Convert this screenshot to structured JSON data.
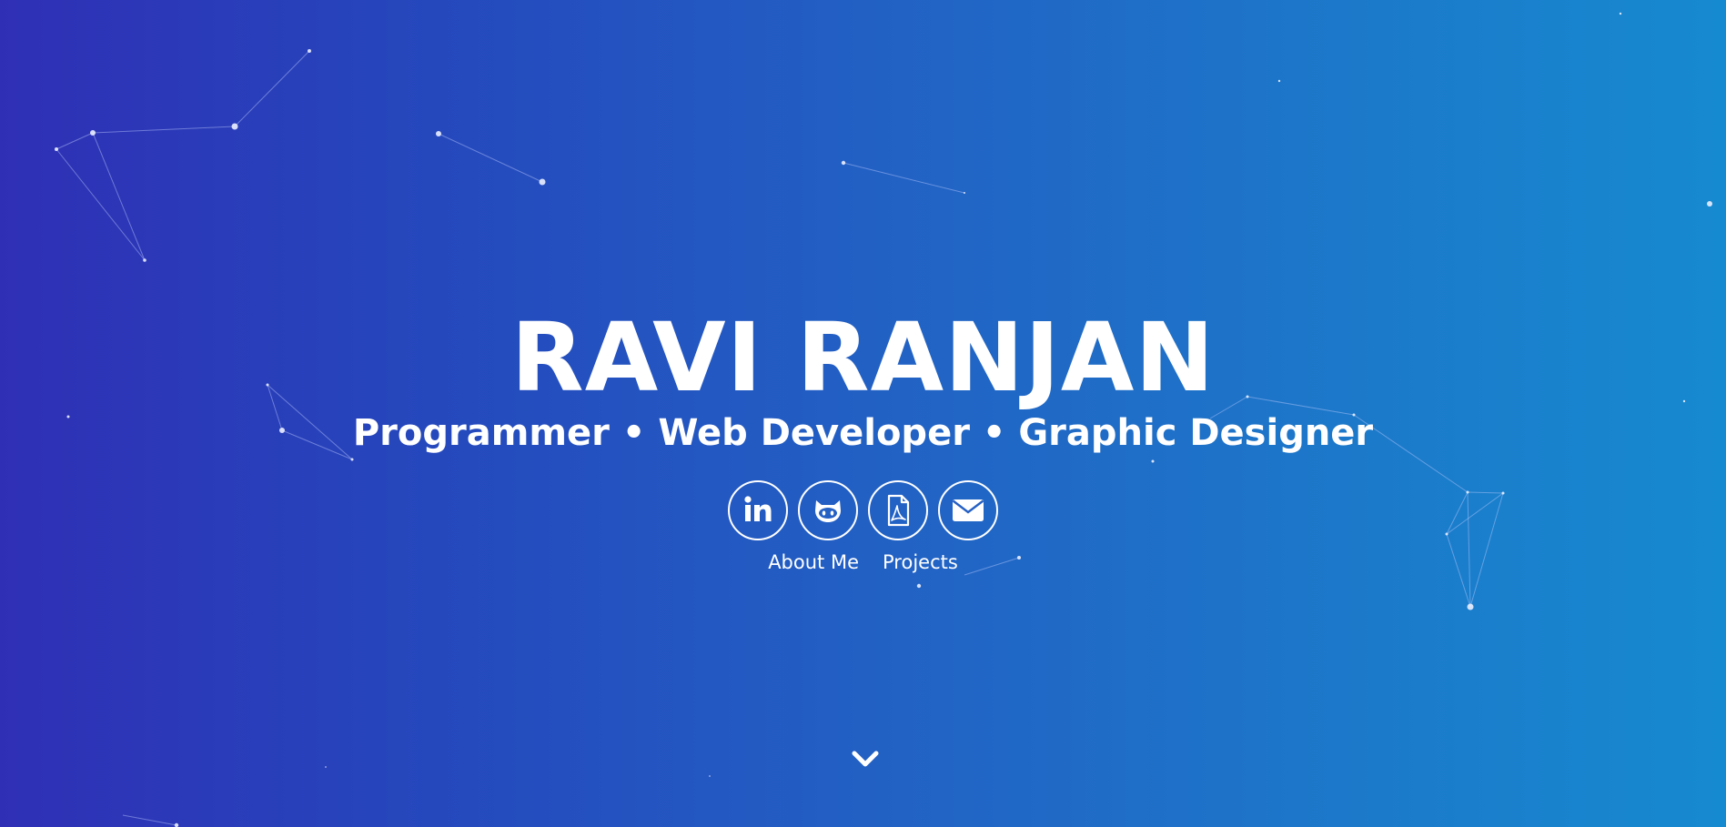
{
  "hero": {
    "name": "RAVI RANJAN",
    "tagline": "Programmer • Web Developer • Graphic Designer"
  },
  "socials": [
    {
      "icon": "linkedin-icon"
    },
    {
      "icon": "github-icon"
    },
    {
      "icon": "pdf-resume-icon"
    },
    {
      "icon": "email-icon"
    }
  ],
  "nav": {
    "about_label": "About Me",
    "projects_label": "Projects"
  },
  "scroll_icon": "chevron-down-icon",
  "colors": {
    "gradient_start": "#2f2fb5",
    "gradient_end": "#168ad0",
    "foreground": "#ffffff"
  }
}
